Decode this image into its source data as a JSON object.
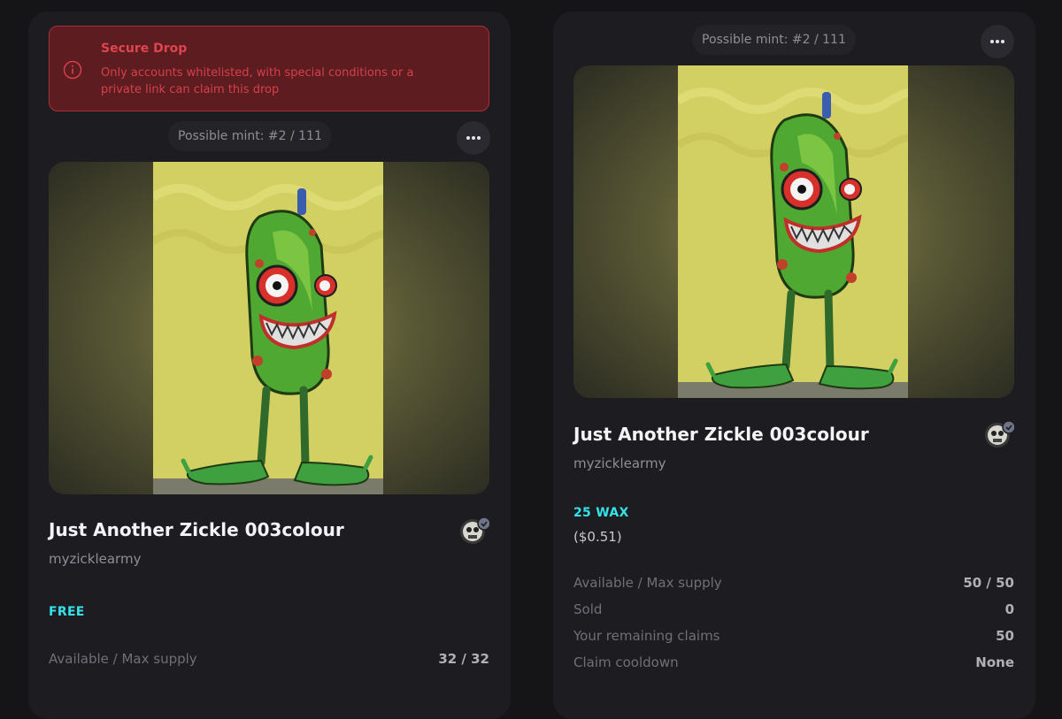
{
  "left_card": {
    "alert": {
      "icon": "info-circle-icon",
      "title": "Secure Drop",
      "text": "Only accounts whitelisted, with special conditions or a private link can claim this drop"
    },
    "mint_label": "Possible mint: #2 / 111",
    "more_icon": "more-dots-icon",
    "title": "Just Another Zickle 003colour",
    "author": "myzicklearmy",
    "price": "FREE",
    "stats": [
      {
        "label": "Available / Max supply",
        "value": "32 / 32"
      }
    ]
  },
  "right_card": {
    "mint_label": "Possible mint: #2 / 111",
    "more_icon": "more-dots-icon",
    "title": "Just Another Zickle 003colour",
    "author": "myzicklearmy",
    "price": "25 WAX",
    "price_usd": "($0.51)",
    "stats": [
      {
        "label": "Available / Max supply",
        "value": "50 / 50"
      },
      {
        "label": "Sold",
        "value": "0"
      },
      {
        "label": "Your remaining claims",
        "value": "50"
      },
      {
        "label": "Claim cooldown",
        "value": "None"
      }
    ]
  },
  "colors": {
    "page_bg": "#151518",
    "card_bg": "#1d1d21",
    "alert_bg": "#5c1c20",
    "alert_text": "#e0454f",
    "price_accent": "#35e2ea"
  }
}
